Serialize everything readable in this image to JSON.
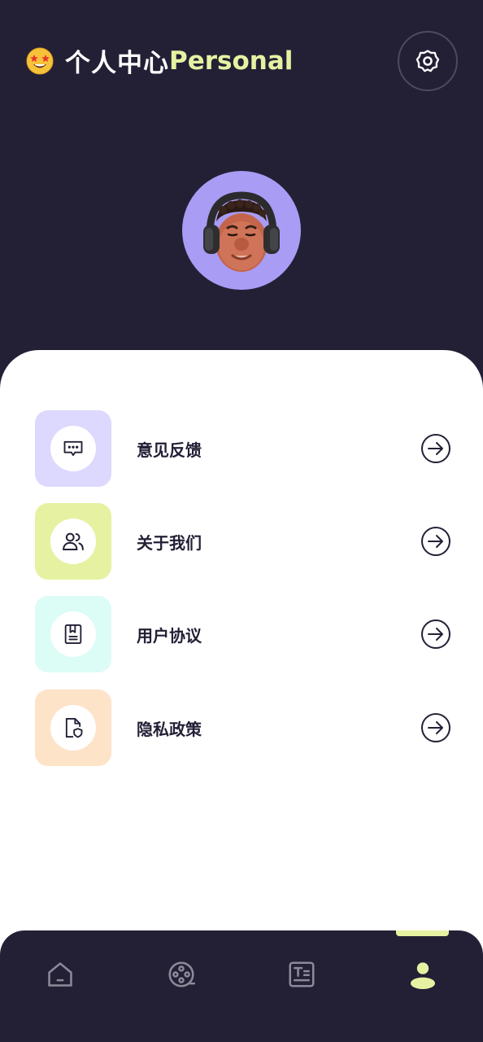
{
  "header": {
    "title_cn": "个人中心",
    "title_en": "Personal",
    "emoji_icon": "star-struck-emoji-icon",
    "settings_icon": "gear-icon"
  },
  "profile": {
    "avatar": "user-avatar-3d-character",
    "avatar_bg": "#a99cf5"
  },
  "menu": {
    "items": [
      {
        "label": "意见反馈",
        "icon": "chat-bubble-icon",
        "tile_color": "#ddd8fd"
      },
      {
        "label": "关于我们",
        "icon": "users-icon",
        "tile_color": "#e6f2a2"
      },
      {
        "label": "用户协议",
        "icon": "document-bookmark-icon",
        "tile_color": "#dcfcf6"
      },
      {
        "label": "隐私政策",
        "icon": "file-shield-icon",
        "tile_color": "#fde3c8"
      }
    ],
    "arrow_icon": "arrow-right-circle-icon"
  },
  "tabbar": {
    "tabs": [
      {
        "name": "home",
        "icon": "home-icon",
        "active": false
      },
      {
        "name": "film",
        "icon": "film-reel-icon",
        "active": false
      },
      {
        "name": "text",
        "icon": "text-document-icon",
        "active": false
      },
      {
        "name": "profile",
        "icon": "user-icon",
        "active": true
      }
    ],
    "active_color": "#e6f2a2",
    "inactive_color": "#8c8a99"
  },
  "colors": {
    "background": "#232036",
    "accent": "#e6f2a2",
    "text_dark": "#232036"
  }
}
